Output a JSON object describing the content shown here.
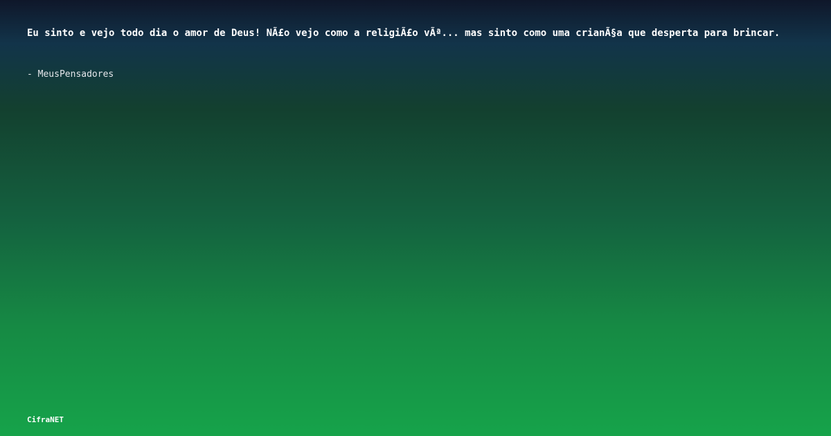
{
  "quote": {
    "text": "Eu sinto e vejo todo dia o amor de Deus! NÃ£o vejo como a religiÃ£o vÃª... mas sinto como uma crianÃ§a que desperta para brincar.",
    "author": "- MeusPensadores"
  },
  "footer": {
    "brand": "CifraNET"
  },
  "colors": {
    "gradient_top": "#0f172a",
    "gradient_bottom": "#16a34a",
    "text": "#ffffff"
  }
}
